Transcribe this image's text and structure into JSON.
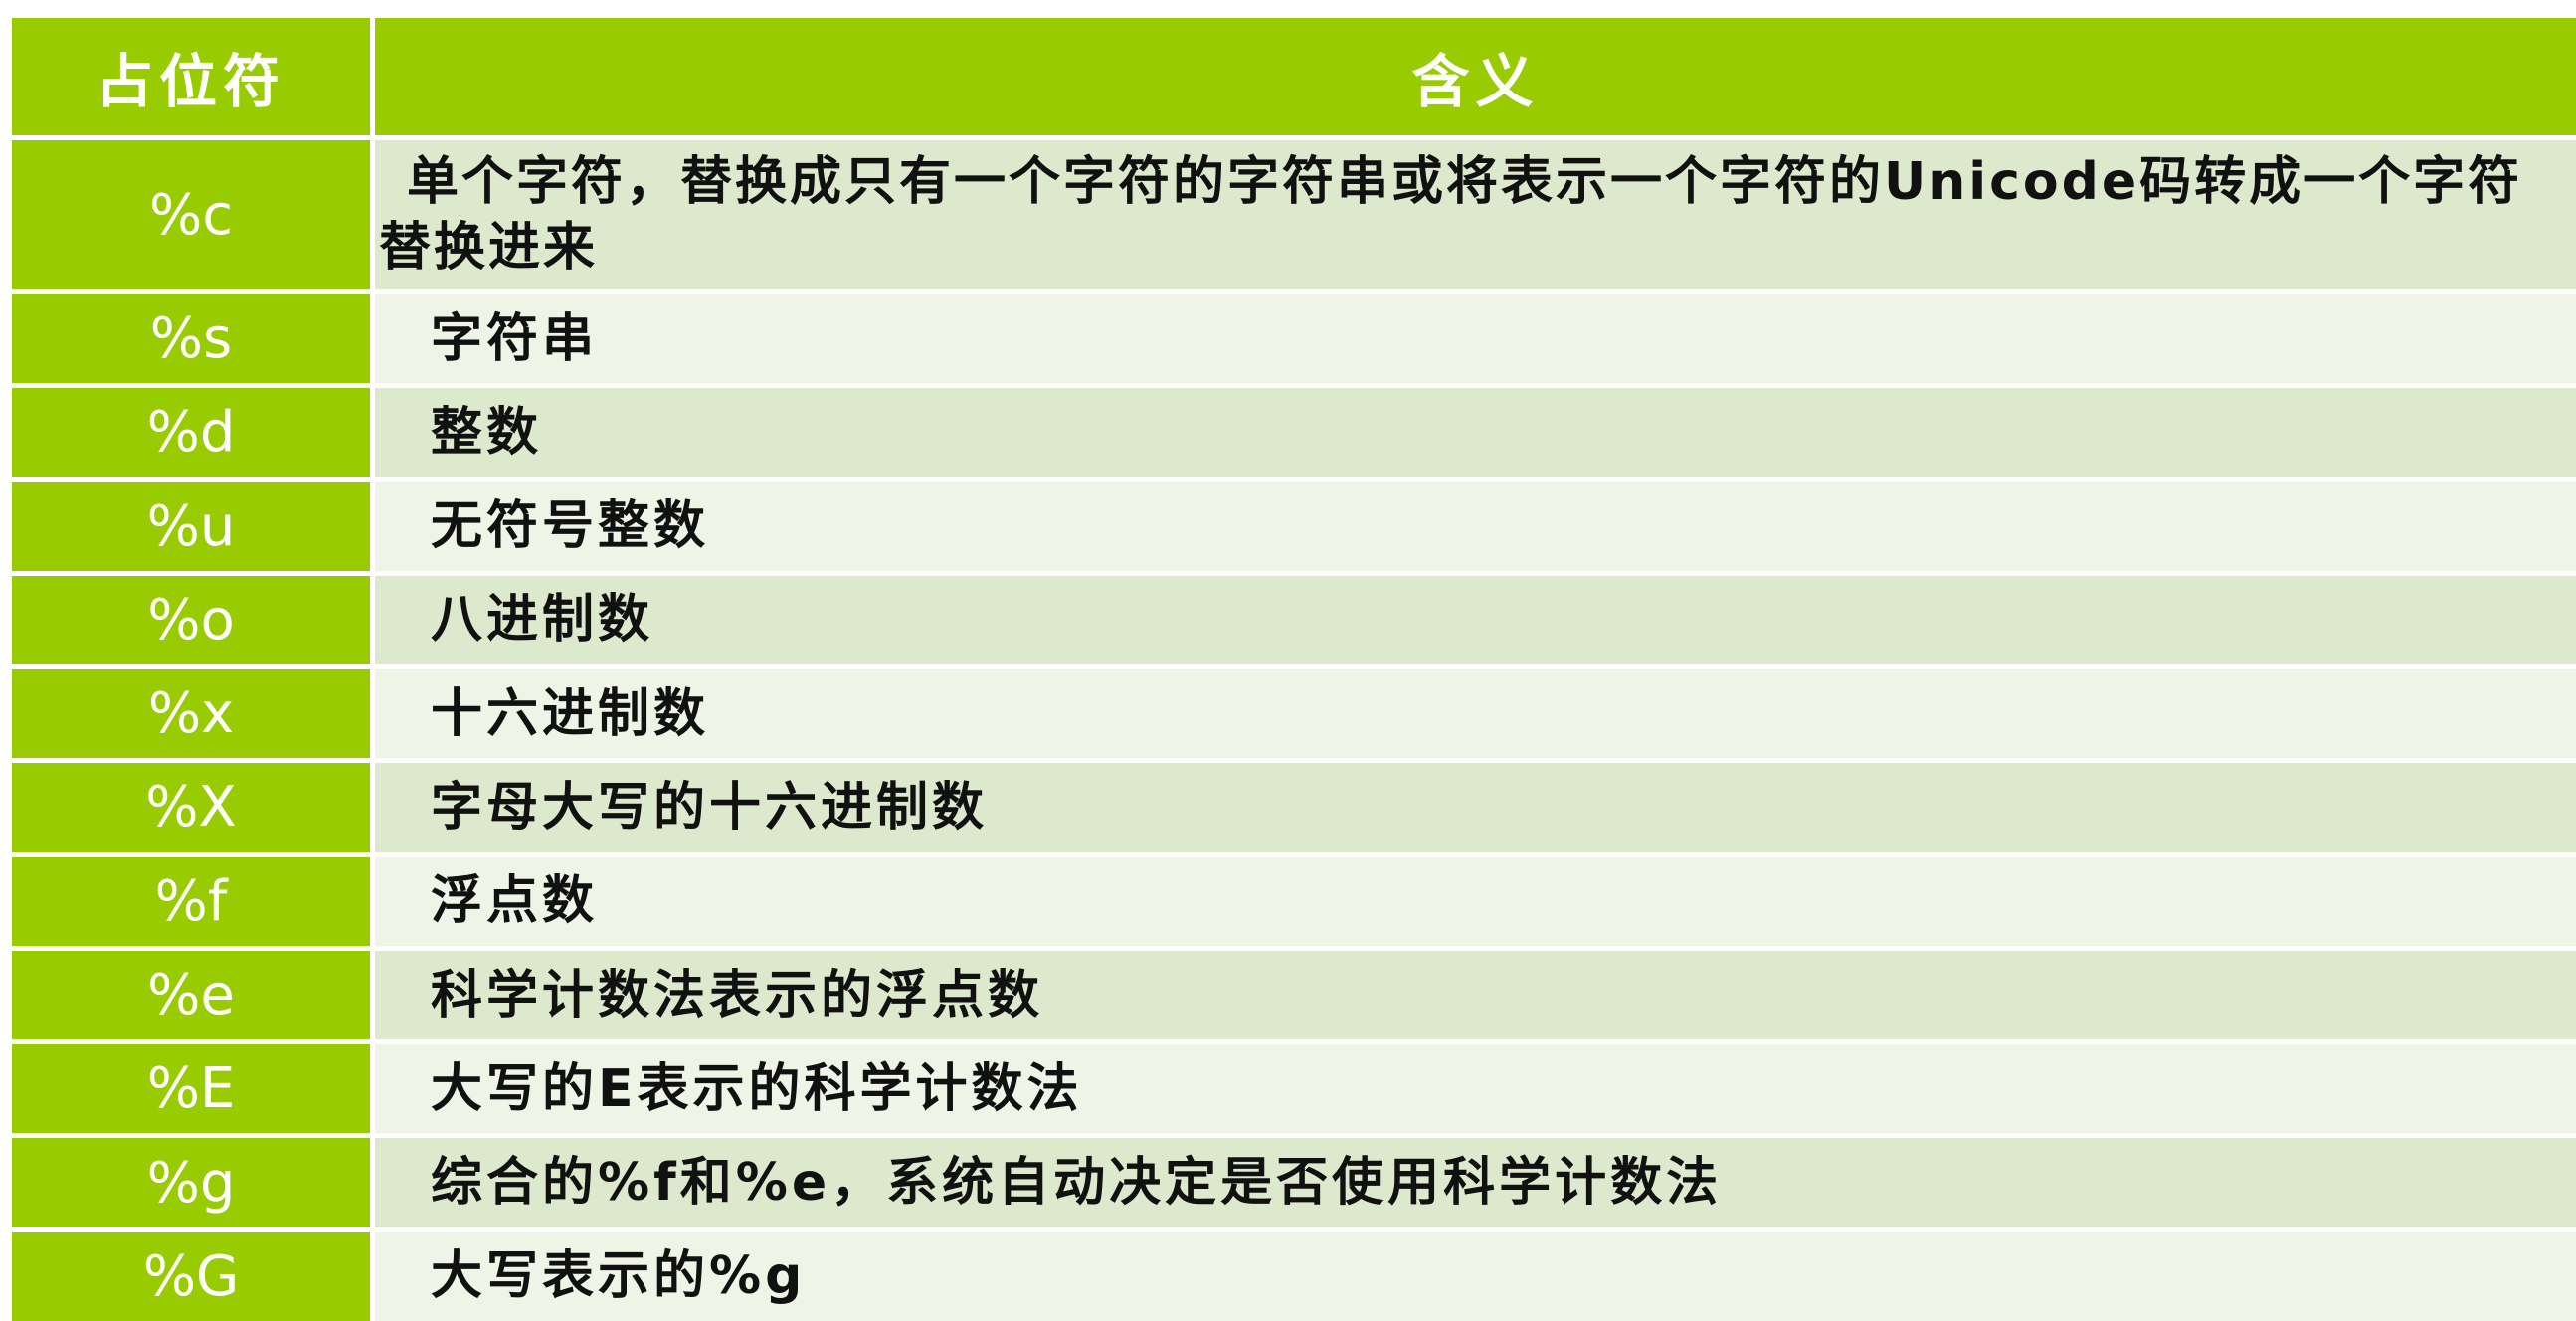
{
  "table": {
    "headers": [
      "占位符",
      "含义"
    ],
    "rows": [
      {
        "code": "%c",
        "desc": "单个字符，替换成只有一个字符的字符串或将表示一个字符的Unicode码转成一个字符替换进来"
      },
      {
        "code": "%s",
        "desc": "字符串"
      },
      {
        "code": "%d",
        "desc": "整数"
      },
      {
        "code": "%u",
        "desc": "无符号整数"
      },
      {
        "code": "%o",
        "desc": "八进制数"
      },
      {
        "code": "%x",
        "desc": "十六进制数"
      },
      {
        "code": "%X",
        "desc": "字母大写的十六进制数"
      },
      {
        "code": "%f",
        "desc": "浮点数"
      },
      {
        "code": "%e",
        "desc": "科学计数法表示的浮点数"
      },
      {
        "code": "%E",
        "desc": "大写的E表示的科学计数法"
      },
      {
        "code": "%g",
        "desc": "综合的%f和%e，系统自动决定是否使用科学计数法"
      },
      {
        "code": "%G",
        "desc": "大写表示的%g"
      }
    ]
  },
  "colors": {
    "header_green": "#99cc00",
    "row_odd": "#dde9cc",
    "row_even": "#eef4e6"
  }
}
